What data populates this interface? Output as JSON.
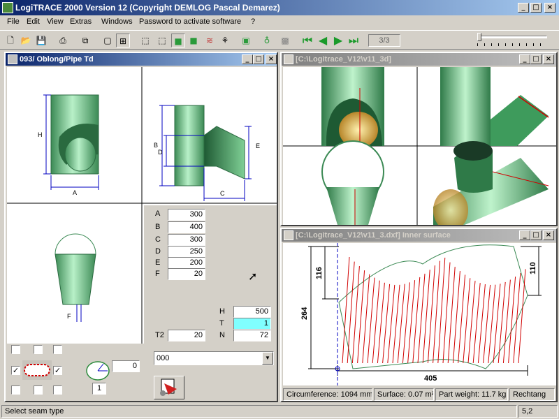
{
  "app": {
    "title": "LogiTRACE 2000  Version 12  (Copyright DEMLOG Pascal Demarez)"
  },
  "menu": [
    "File",
    "Edit",
    "View",
    "Extras",
    "Windows",
    "Password to activate software",
    "?"
  ],
  "toolbar": {
    "page_indicator": "3/3"
  },
  "window_param": {
    "title": "093/ Oblong/Pipe Td",
    "fields": [
      {
        "label": "A",
        "value": "300"
      },
      {
        "label": "B",
        "value": "400"
      },
      {
        "label": "C",
        "value": "300"
      },
      {
        "label": "D",
        "value": "250"
      },
      {
        "label": "E",
        "value": "200"
      },
      {
        "label": "F",
        "value": "20"
      }
    ],
    "t2_label": "T2",
    "t2_value": "20",
    "h_label": "H",
    "h_value": "500",
    "t_label": "T",
    "t_value": "1",
    "n_label": "N",
    "n_value": "72",
    "angle_value": "0",
    "count_value": "1",
    "combo_value": "000",
    "dim_labels": {
      "A": "A",
      "B": "B",
      "C": "C",
      "D": "D",
      "E": "E",
      "F": "F",
      "H": "H"
    }
  },
  "window_3d": {
    "title": "[C:\\Logitrace_V12\\v11_3d]"
  },
  "window_dxf": {
    "title": "[C:\\Logitrace_V12\\v11_3.dxf]  Inner surface",
    "dims": {
      "left_top": "116",
      "right_top": "110",
      "height": "264",
      "width": "405"
    }
  },
  "info": {
    "circumference": "Circumference: 1094 mm",
    "surface": "Surface: 0.07 m²",
    "weight": "Part weight: 11.7 kg",
    "type": "Rechtang"
  },
  "status": {
    "message": "Select seam type",
    "coords": "5,2"
  },
  "colors": {
    "pipe_green": "#7fd49a",
    "dim_blue": "#0000c0",
    "line_red": "#d00000"
  }
}
